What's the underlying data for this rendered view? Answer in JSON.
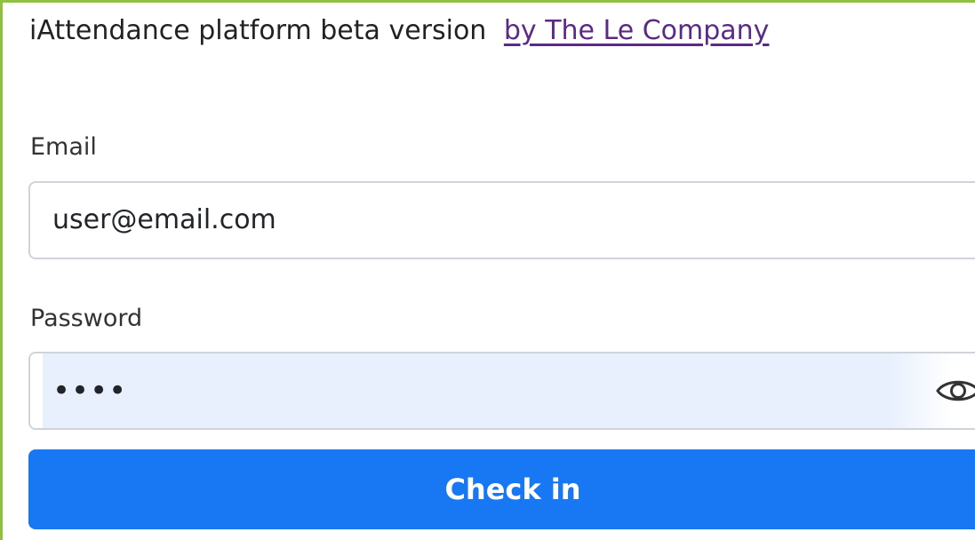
{
  "header": {
    "title": "iAttendance platform beta version",
    "link": "by The Le Company"
  },
  "form": {
    "email_label": "Email",
    "email_value": "user@email.com",
    "password_label": "Password",
    "password_value": "••••",
    "submit_label": "Check in"
  },
  "icons": {
    "password_toggle": "eye-icon"
  },
  "colors": {
    "accent": "#1877f2",
    "link": "#5b2a86",
    "frame": "#8fc13e",
    "autofill": "#e8f0fe"
  }
}
